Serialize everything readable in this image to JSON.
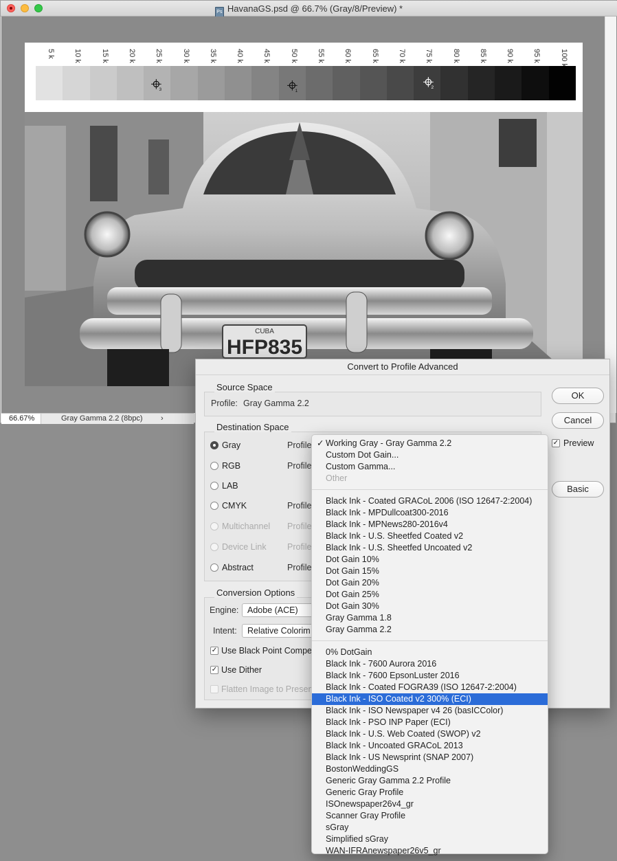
{
  "window": {
    "title": "HavanaGS.psd @ 66.7% (Gray/8/Preview) *",
    "app_icon_text": "Ps"
  },
  "document": {
    "scale_labels": [
      "5 k",
      "10 k",
      "15 k",
      "20 k",
      "25 k",
      "30 k",
      "35 k",
      "40 k",
      "45 k",
      "50 k",
      "55 k",
      "60 k",
      "65 k",
      "70 k",
      "75 k",
      "80 k",
      "85 k",
      "90 k",
      "95 k",
      "100 k"
    ],
    "target_labels": [
      "3",
      "1",
      "2"
    ],
    "plate_text": "HFP835",
    "plate_top": "CUBA"
  },
  "statusbar": {
    "zoom": "66.67%",
    "info": "Gray Gamma 2.2 (8bpc)",
    "arrow": "›"
  },
  "dialog": {
    "title": "Convert to Profile Advanced",
    "source": {
      "label": "Source Space",
      "profile_prefix": "Profile:",
      "profile_value": "Gray Gamma 2.2"
    },
    "destination": {
      "label": "Destination Space",
      "options": [
        {
          "label": "Gray",
          "profile": "Profile",
          "selected": true,
          "enabled": true
        },
        {
          "label": "RGB",
          "profile": "Profile",
          "selected": false,
          "enabled": true
        },
        {
          "label": "LAB",
          "profile": "",
          "selected": false,
          "enabled": true
        },
        {
          "label": "CMYK",
          "profile": "Profile",
          "selected": false,
          "enabled": true
        },
        {
          "label": "Multichannel",
          "profile": "Profile",
          "selected": false,
          "enabled": false
        },
        {
          "label": "Device Link",
          "profile": "Profile",
          "selected": false,
          "enabled": false
        },
        {
          "label": "Abstract",
          "profile": "Profile",
          "selected": false,
          "enabled": true
        }
      ]
    },
    "conversion": {
      "label": "Conversion Options",
      "engine_label": "Engine:",
      "engine_value": "Adobe (ACE)",
      "intent_label": "Intent:",
      "intent_value": "Relative Colorim",
      "black_point": "Use Black Point Compe",
      "dither": "Use Dither",
      "flatten": "Flatten Image to Presen"
    },
    "buttons": {
      "ok": "OK",
      "cancel": "Cancel",
      "basic": "Basic"
    },
    "preview_label": "Preview",
    "check_mark": "✓"
  },
  "menu": {
    "check_mark": "✓",
    "group1": [
      "Working Gray - Gray Gamma 2.2",
      "Custom Dot Gain...",
      "Custom Gamma...",
      "Other"
    ],
    "group2": [
      "Black Ink - Coated GRACoL 2006 (ISO 12647-2:2004)",
      "Black Ink - MPDullcoat300-2016",
      "Black Ink - MPNews280-2016v4",
      "Black Ink - U.S. Sheetfed Coated v2",
      "Black Ink - U.S. Sheetfed Uncoated v2",
      "Dot Gain 10%",
      "Dot Gain 15%",
      "Dot Gain 20%",
      "Dot Gain 25%",
      "Dot Gain 30%",
      "Gray Gamma 1.8",
      "Gray Gamma 2.2"
    ],
    "group3": [
      "0% DotGain",
      "Black Ink - 7600 Aurora 2016",
      "Black Ink - 7600 EpsonLuster 2016",
      "Black Ink - Coated FOGRA39 (ISO 12647-2:2004)",
      "Black Ink - ISO Coated v2 300% (ECI)",
      "Black Ink - ISO Newspaper v4 26 (basICColor)",
      "Black Ink - PSO INP Paper (ECI)",
      "Black Ink - U.S. Web Coated (SWOP) v2",
      "Black Ink - Uncoated GRACoL 2013",
      "Black Ink - US Newsprint (SNAP 2007)",
      "BostonWeddingGS",
      "Generic Gray Gamma 2.2 Profile",
      "Generic Gray Profile",
      "ISOnewspaper26v4_gr",
      "Scanner Gray Profile",
      "sGray",
      "Simplified sGray",
      "WAN-IFRAnewspaper26v5_gr"
    ]
  },
  "colors": {
    "selection": "#2b6cd8",
    "canvas_gray": "#8a8a8a"
  }
}
